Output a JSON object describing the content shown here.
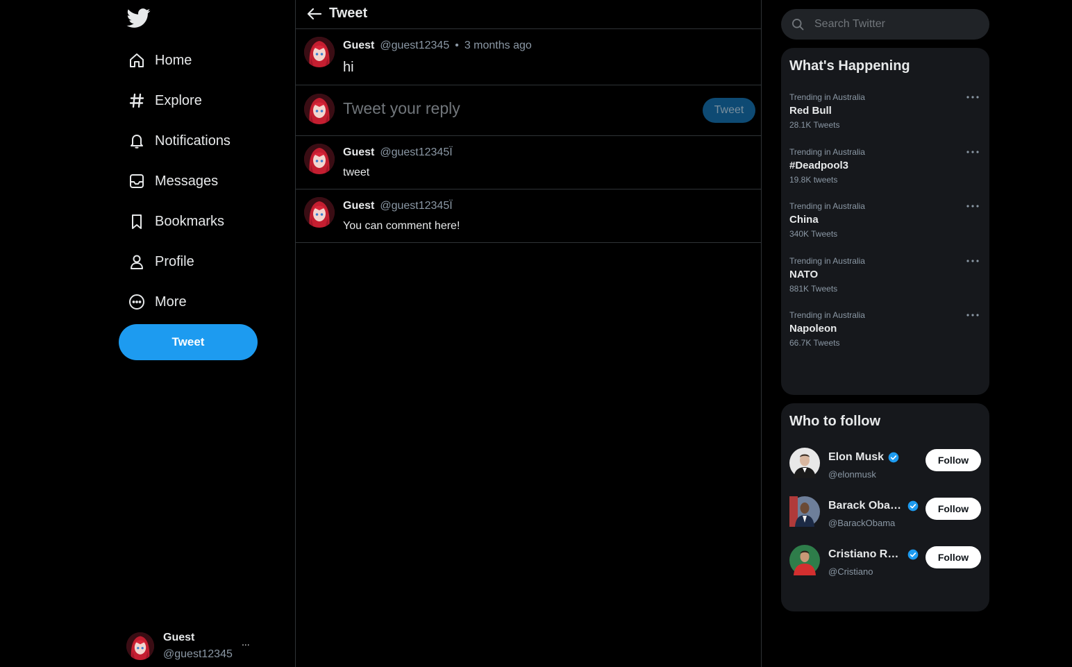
{
  "colors": {
    "accent": "#1d9bf0",
    "background": "#000000",
    "panel": "#16181c",
    "border": "#2f3336",
    "muted": "#8b98a5"
  },
  "sidebar": {
    "logo_icon": "twitter-bird-icon",
    "items": [
      {
        "label": "Home",
        "icon": "home-icon"
      },
      {
        "label": "Explore",
        "icon": "hashtag-icon"
      },
      {
        "label": "Notifications",
        "icon": "bell-icon"
      },
      {
        "label": "Messages",
        "icon": "inbox-icon"
      },
      {
        "label": "Bookmarks",
        "icon": "bookmark-icon"
      },
      {
        "label": "Profile",
        "icon": "user-icon"
      },
      {
        "label": "More",
        "icon": "more-circle-icon"
      }
    ],
    "tweet_button": "Tweet",
    "account": {
      "name": "Guest",
      "handle": "@guest12345",
      "more": "..."
    }
  },
  "main": {
    "header": {
      "title": "Tweet",
      "back_icon": "arrow-left-icon"
    },
    "tweet": {
      "name": "Guest",
      "handle": "@guest12345",
      "dot": "•",
      "time": "3 months ago",
      "text": "hi"
    },
    "reply": {
      "placeholder": "Tweet your reply",
      "button": "Tweet"
    },
    "replies": [
      {
        "name": "Guest",
        "handle": "@guest12345Ï",
        "text": "tweet"
      },
      {
        "name": "Guest",
        "handle": "@guest12345Ï",
        "text": "You can comment here!"
      }
    ]
  },
  "right": {
    "search": {
      "placeholder": "Search Twitter"
    },
    "trends": {
      "title": "What's Happening",
      "items": [
        {
          "context": "Trending in Australia",
          "name": "Red Bull",
          "count": "28.1K Tweets"
        },
        {
          "context": "Trending in Australia",
          "name": "#Deadpool3",
          "count": "19.8K tweets"
        },
        {
          "context": "Trending in Australia",
          "name": "China",
          "count": "340K Tweets"
        },
        {
          "context": "Trending in Australia",
          "name": "NATO",
          "count": "881K Tweets"
        },
        {
          "context": "Trending in Australia",
          "name": "Napoleon",
          "count": "66.7K Tweets"
        }
      ]
    },
    "follow": {
      "title": "Who to follow",
      "items": [
        {
          "name": "Elon Musk",
          "handle": "@elonmusk",
          "button": "Follow"
        },
        {
          "name": "Barack Obama",
          "handle": "@BarackObama",
          "button": "Follow"
        },
        {
          "name": "Cristiano Ronaldo",
          "handle": "@Cristiano",
          "button": "Follow"
        }
      ]
    }
  }
}
